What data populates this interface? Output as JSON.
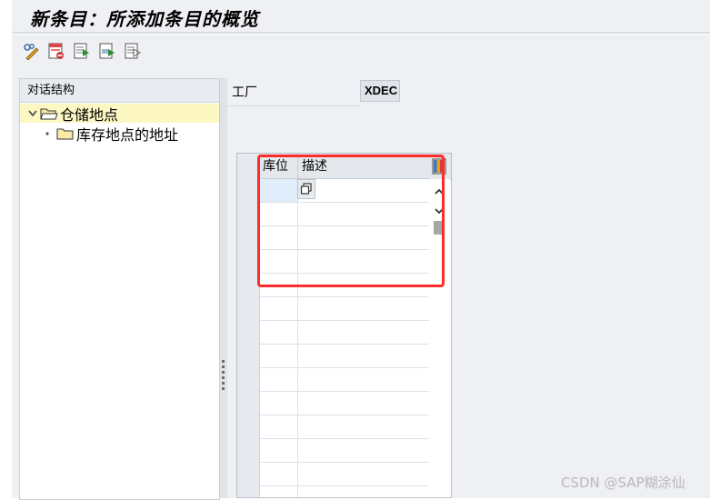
{
  "window": {
    "title": "新条目：所添加条目的概览"
  },
  "toolbar": {
    "buttons": [
      {
        "icon": "change-display-icon"
      },
      {
        "icon": "delete-entry-icon"
      },
      {
        "icon": "select-all-icon"
      },
      {
        "icon": "select-block-icon"
      },
      {
        "icon": "deselect-all-icon"
      }
    ]
  },
  "tree": {
    "header": "对话结构",
    "items": [
      {
        "label": "仓储地点",
        "level": 0,
        "expanded": true,
        "selected": true
      },
      {
        "label": "库存地点的地址",
        "level": 1,
        "expanded": false,
        "selected": false
      }
    ]
  },
  "plant": {
    "label": "工厂",
    "value": "XDEC"
  },
  "table": {
    "columns": [
      "库位",
      "描述"
    ],
    "rows": [
      {
        "storage_location": "",
        "description": ""
      },
      {
        "storage_location": "",
        "description": ""
      },
      {
        "storage_location": "",
        "description": ""
      },
      {
        "storage_location": "",
        "description": ""
      },
      {
        "storage_location": "",
        "description": ""
      },
      {
        "storage_location": "",
        "description": ""
      },
      {
        "storage_location": "",
        "description": ""
      },
      {
        "storage_location": "",
        "description": ""
      },
      {
        "storage_location": "",
        "description": ""
      },
      {
        "storage_location": "",
        "description": ""
      },
      {
        "storage_location": "",
        "description": ""
      },
      {
        "storage_location": "",
        "description": ""
      },
      {
        "storage_location": "",
        "description": ""
      },
      {
        "storage_location": "",
        "description": ""
      }
    ]
  },
  "watermark": "CSDN @SAP糊涂仙",
  "colors": {
    "highlight_box": "#ff2b2b",
    "tree_selected": "#fdf7c4",
    "folder": "#f5d76e"
  }
}
